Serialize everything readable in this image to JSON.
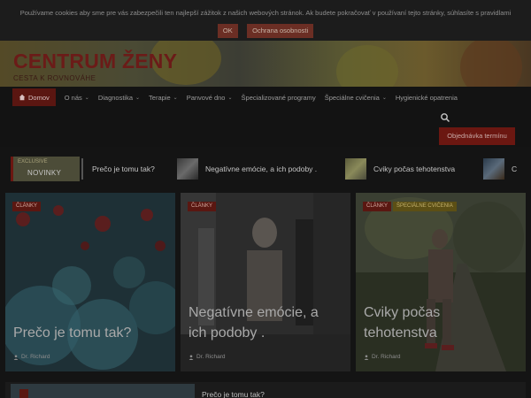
{
  "cookie": {
    "text": "Používame cookies aby sme pre vás zabezpečili ten najlepší zážitok z našich webových stránok. Ak budete pokračovať v používaní tejto stránky, súhlasíte s pravidlami",
    "ok_label": "OK",
    "policy_label": "Ochrana osobnosti"
  },
  "header": {
    "title": "CENTRUM ŽENY",
    "tagline": "CESTA K ROVNOVÁHE"
  },
  "nav": {
    "home_label": "Domov",
    "items": [
      {
        "label": "O nás",
        "has_dropdown": true
      },
      {
        "label": "Diagnostika",
        "has_dropdown": true
      },
      {
        "label": "Terapie",
        "has_dropdown": true
      },
      {
        "label": "Panvové dno",
        "has_dropdown": true
      },
      {
        "label": "Špecializované programy",
        "has_dropdown": false
      },
      {
        "label": "Špeciálne cvičenia",
        "has_dropdown": true
      },
      {
        "label": "Hygienické opatrenia",
        "has_dropdown": false
      }
    ],
    "search_icon": "search-icon",
    "order_label": "Objednávka termínu"
  },
  "ticker": {
    "badge_small": "EXCLUSIVE",
    "badge_main": "NOVINKY",
    "items": [
      {
        "title": "Prečo je tomu tak?"
      },
      {
        "title": "Negatívne emócie, a ich podoby ."
      },
      {
        "title": "Cviky počas tehotenstva"
      },
      {
        "title": "C"
      }
    ]
  },
  "cards": [
    {
      "badges": [
        "ČLÁNKY"
      ],
      "title_line1": "Prečo je tomu tak?",
      "title_line2": "",
      "author": "Dr. Richard"
    },
    {
      "badges": [
        "ČLÁNKY"
      ],
      "title_line1": "Negatívne emócie, a",
      "title_line2": "ich podoby .",
      "author": "Dr. Richard"
    },
    {
      "badges": [
        "ČLÁNKY",
        "ŠPECIÁLNE CVIČENIA"
      ],
      "title_line1": "Cviky počas",
      "title_line2": "tehotenstva",
      "author": "Dr. Richard"
    }
  ],
  "bottom": {
    "title": "Prečo je tomu tak?"
  },
  "colors": {
    "accent": "#6b1711",
    "overlay_bg": "#141414"
  }
}
